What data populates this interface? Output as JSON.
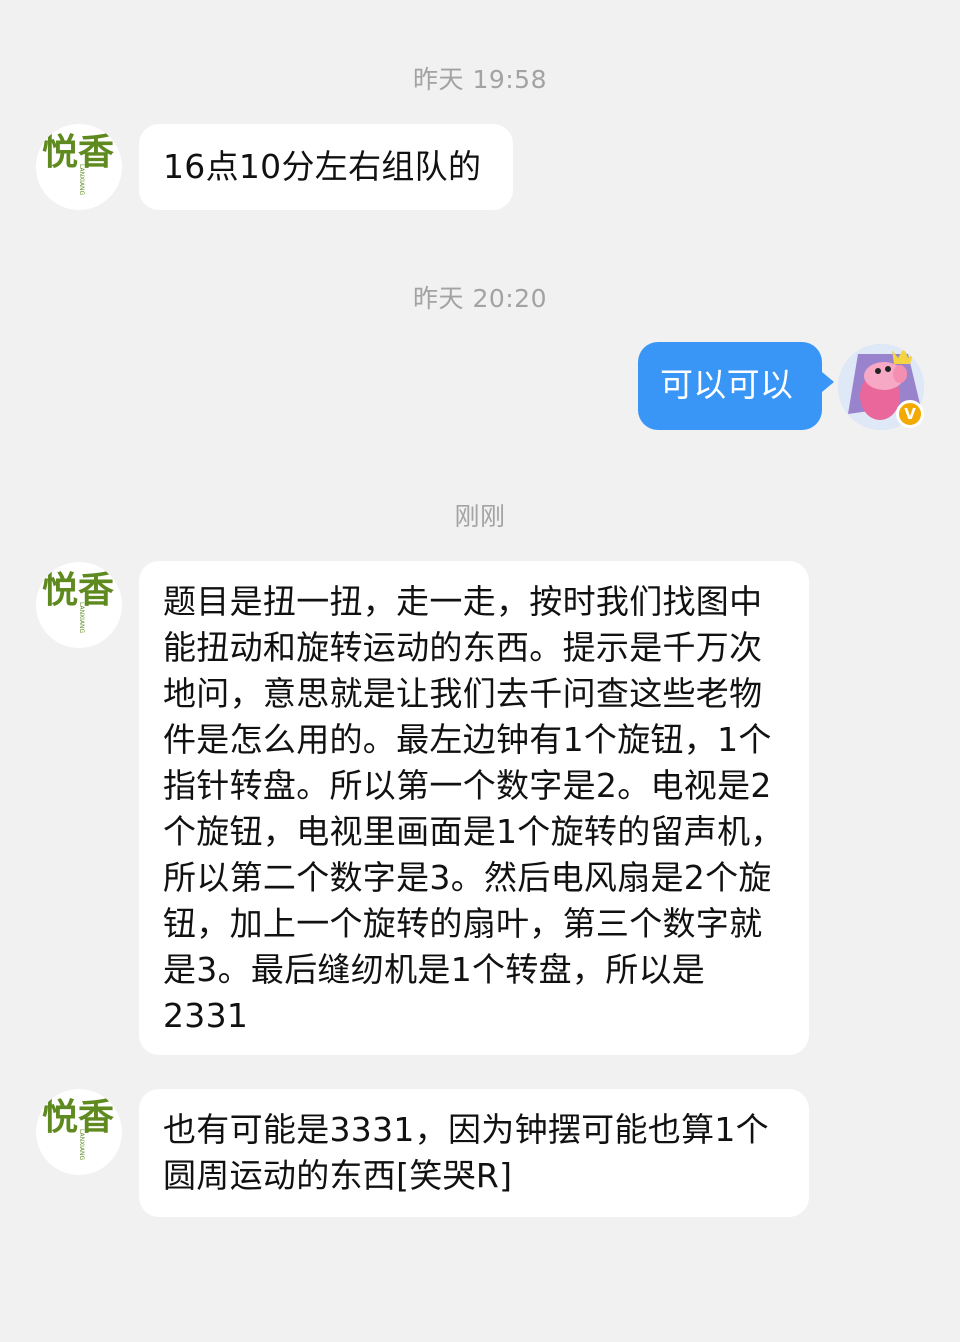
{
  "timestamps": {
    "t1": "昨天 19:58",
    "t2": "昨天 20:20",
    "t3": "刚刚"
  },
  "messages": [
    {
      "sender": "悦香",
      "text": "16点10分左右组队的"
    },
    {
      "sender": "self",
      "text": "可以可以"
    },
    {
      "sender": "悦香",
      "text": "题目是扭一扭，走一走，按时我们找图中能扭动和旋转运动的东西。提示是千万次地问，意思就是让我们去千问查这些老物件是怎么用的。最左边钟有1个旋钮，1个指针转盘。所以第一个数字是2。电视是2个旋钮，电视里画面是1个旋转的留声机，所以第二个数字是3。然后电风扇是2个旋钮，加上一个旋转的扇叶，第三个数字就是3。最后缝纫机是1个转盘，所以是2331"
    },
    {
      "sender": "悦香",
      "text": "也有可能是3331，因为钟摆可能也算1个圆周运动的东西[笑哭R]"
    }
  ],
  "avatars": {
    "contact_logo": "悦香",
    "contact_logo_small": "LANXIANG",
    "self_icon": "peppa-pig-avatar-icon",
    "badge_label": "V"
  },
  "colors": {
    "background": "#f1f1f1",
    "own_bubble": "#3996f6",
    "other_bubble": "#ffffff",
    "timestamp": "#a3a3a3",
    "logo_green": "#5e8a1f"
  }
}
